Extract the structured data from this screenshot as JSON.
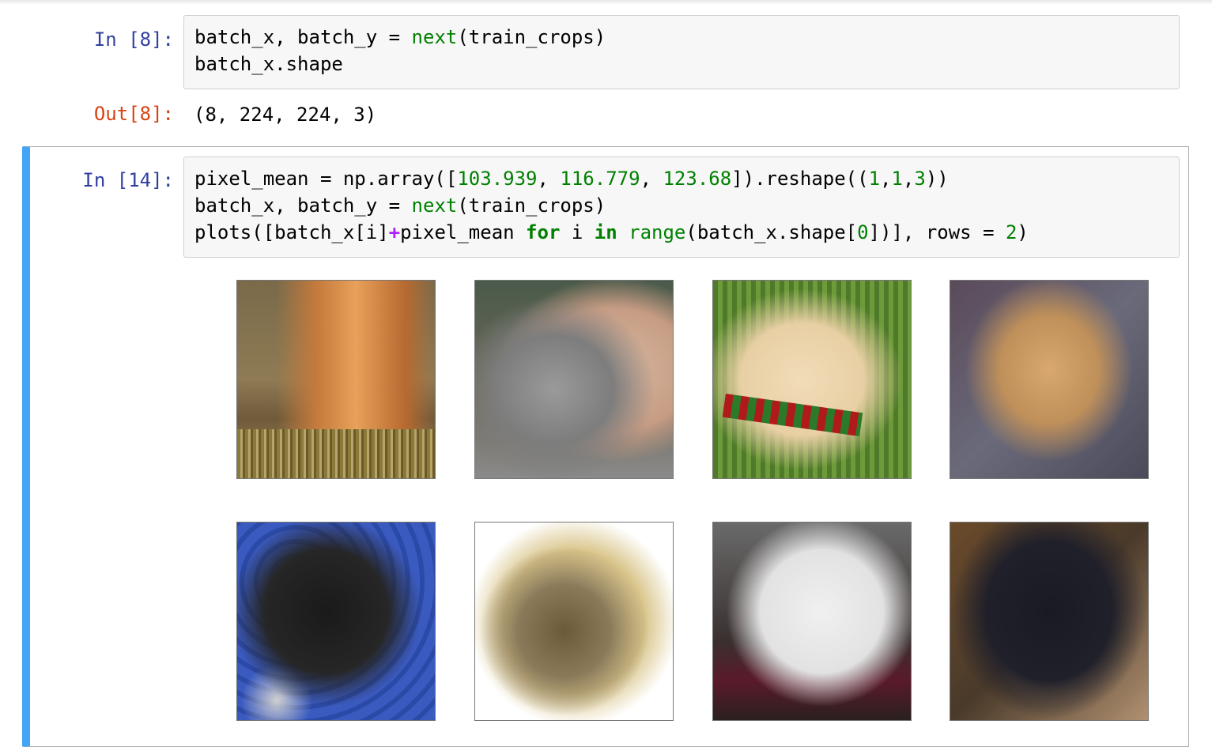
{
  "cells": [
    {
      "prompt": "In [8]:",
      "code_lines": [
        [
          {
            "t": "batch_x, batch_y = ",
            "c": ""
          },
          {
            "t": "next",
            "c": "fn"
          },
          {
            "t": "(train_crops)",
            "c": ""
          }
        ],
        [
          {
            "t": "batch_x.shape",
            "c": ""
          }
        ]
      ],
      "out_prompt": "Out[8]:",
      "output": "(8, 224, 224, 3)"
    },
    {
      "prompt": "In [14]:",
      "code_lines": [
        [
          {
            "t": "pixel_mean = np.array([",
            "c": ""
          },
          {
            "t": "103.939",
            "c": "num"
          },
          {
            "t": ", ",
            "c": ""
          },
          {
            "t": "116.779",
            "c": "num"
          },
          {
            "t": ", ",
            "c": ""
          },
          {
            "t": "123.68",
            "c": "num"
          },
          {
            "t": "]).reshape((",
            "c": ""
          },
          {
            "t": "1",
            "c": "num"
          },
          {
            "t": ",",
            "c": ""
          },
          {
            "t": "1",
            "c": "num"
          },
          {
            "t": ",",
            "c": ""
          },
          {
            "t": "3",
            "c": "num"
          },
          {
            "t": "))",
            "c": ""
          }
        ],
        [
          {
            "t": "batch_x, batch_y = ",
            "c": ""
          },
          {
            "t": "next",
            "c": "fn"
          },
          {
            "t": "(train_crops)",
            "c": ""
          }
        ],
        [
          {
            "t": "plots([batch_x[i]",
            "c": ""
          },
          {
            "t": "+",
            "c": "op"
          },
          {
            "t": "pixel_mean ",
            "c": ""
          },
          {
            "t": "for",
            "c": "kw"
          },
          {
            "t": " i ",
            "c": ""
          },
          {
            "t": "in",
            "c": "kw"
          },
          {
            "t": " ",
            "c": ""
          },
          {
            "t": "range",
            "c": "fn"
          },
          {
            "t": "(batch_x.shape[",
            "c": ""
          },
          {
            "t": "0",
            "c": "num"
          },
          {
            "t": "])], rows = ",
            "c": ""
          },
          {
            "t": "2",
            "c": "num"
          },
          {
            "t": ")",
            "c": ""
          }
        ]
      ],
      "images": [
        "collie-dog-image",
        "tabby-cat-image",
        "cream-dog-bandana-image",
        "pekingese-dog-image",
        "tuxedo-cat-image",
        "kittens-basket-image",
        "white-cat-image",
        "dachshund-dog-image"
      ]
    }
  ],
  "colors": {
    "in_prompt": "#303f9f",
    "out_prompt": "#d84315",
    "selected_bar": "#42a5f5",
    "code_green": "#008000",
    "operator_purple": "#aa22ff"
  }
}
